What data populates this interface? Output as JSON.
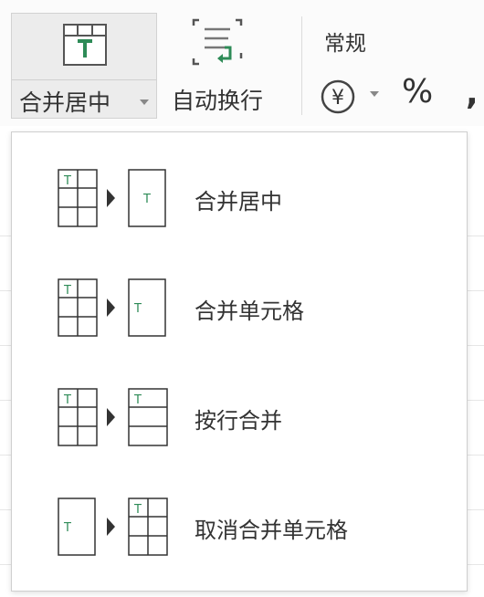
{
  "ribbon": {
    "merge_center_label": "合并居中",
    "wrap_text_label": "自动换行",
    "number_format_label": "常规",
    "currency_symbol": "¥",
    "percent_symbol": "%",
    "comma_symbol": ","
  },
  "menu": {
    "items": [
      {
        "label": "合并居中",
        "icon": "merge-center-icon"
      },
      {
        "label": "合并单元格",
        "icon": "merge-cells-icon"
      },
      {
        "label": "按行合并",
        "icon": "merge-by-row-icon"
      },
      {
        "label": "取消合并单元格",
        "icon": "unmerge-cells-icon"
      }
    ]
  },
  "colors": {
    "accent_green": "#2e8b57",
    "text": "#333333",
    "border": "#cfcfcf"
  }
}
